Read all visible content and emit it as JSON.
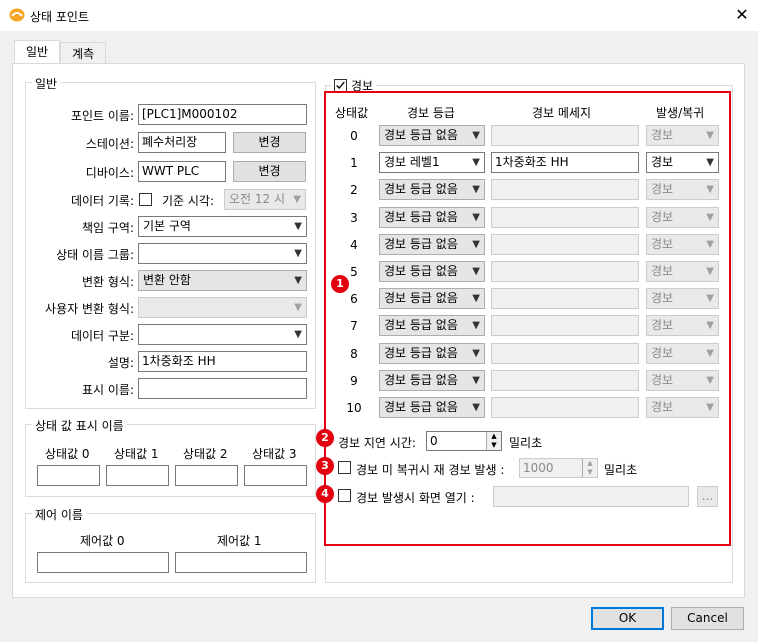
{
  "window": {
    "title": "상태 포인트"
  },
  "tabs": [
    "일반",
    "계측"
  ],
  "general": {
    "group_label": "일반",
    "point_name_label": "포인트 이름:",
    "point_name_value": "[PLC1]M000102",
    "station_label": "스테이션:",
    "station_value": "폐수처리장",
    "change_label": "변경",
    "device_label": "디바이스:",
    "device_value": "WWT PLC",
    "data_record_label": "데이터 기록:",
    "base_time_label": "기준 시각:",
    "base_time_value": "오전 12 시",
    "resp_area_label": "책임 구역:",
    "resp_area_value": "기본 구역",
    "state_group_label": "상태 이름 그룹:",
    "conv_format_label": "변환 형식:",
    "conv_format_value": "변환 안함",
    "user_conv_label": "사용자 변환 형식:",
    "data_class_label": "데이터 구분:",
    "desc_label": "설명:",
    "desc_value": "1차중화조 HH",
    "display_name_label": "표시 이름:"
  },
  "state_display": {
    "group_label": "상태 값 표시 이름",
    "labels": [
      "상태값 0",
      "상태값 1",
      "상태값 2",
      "상태값 3"
    ]
  },
  "control": {
    "group_label": "제어 이름",
    "labels": [
      "제어값 0",
      "제어값 1"
    ]
  },
  "alarm": {
    "checkbox_label": "경보",
    "headers": {
      "state": "상태값",
      "level": "경보 등급",
      "message": "경보 메세지",
      "occur": "발생/복귀"
    },
    "rows": [
      {
        "state": "0",
        "level": "경보 등급 없음",
        "message": "",
        "occur": "경보"
      },
      {
        "state": "1",
        "level": "경보 레벨1",
        "message": "1차중화조 HH",
        "occur": "경보"
      },
      {
        "state": "2",
        "level": "경보 등급 없음",
        "message": "",
        "occur": "경보"
      },
      {
        "state": "3",
        "level": "경보 등급 없음",
        "message": "",
        "occur": "경보"
      },
      {
        "state": "4",
        "level": "경보 등급 없음",
        "message": "",
        "occur": "경보"
      },
      {
        "state": "5",
        "level": "경보 등급 없음",
        "message": "",
        "occur": "경보"
      },
      {
        "state": "6",
        "level": "경보 등급 없음",
        "message": "",
        "occur": "경보"
      },
      {
        "state": "7",
        "level": "경보 등급 없음",
        "message": "",
        "occur": "경보"
      },
      {
        "state": "8",
        "level": "경보 등급 없음",
        "message": "",
        "occur": "경보"
      },
      {
        "state": "9",
        "level": "경보 등급 없음",
        "message": "",
        "occur": "경보"
      },
      {
        "state": "10",
        "level": "경보 등급 없음",
        "message": "",
        "occur": "경보"
      }
    ],
    "delay_label": "경보 지연 시간:",
    "delay_value": "0",
    "ms_label": "밀리초",
    "repeat_label": "경보 미 복귀시 재 경보 발생 :",
    "repeat_value": "1000",
    "open_screen_label": "경보 발생시 화면 열기 :",
    "browse_label": "..."
  },
  "badges": [
    "1",
    "2",
    "3",
    "4"
  ],
  "buttons": {
    "ok": "OK",
    "cancel": "Cancel"
  },
  "colors": {
    "highlight": "#e3000f",
    "ok_border": "#0078d7"
  }
}
